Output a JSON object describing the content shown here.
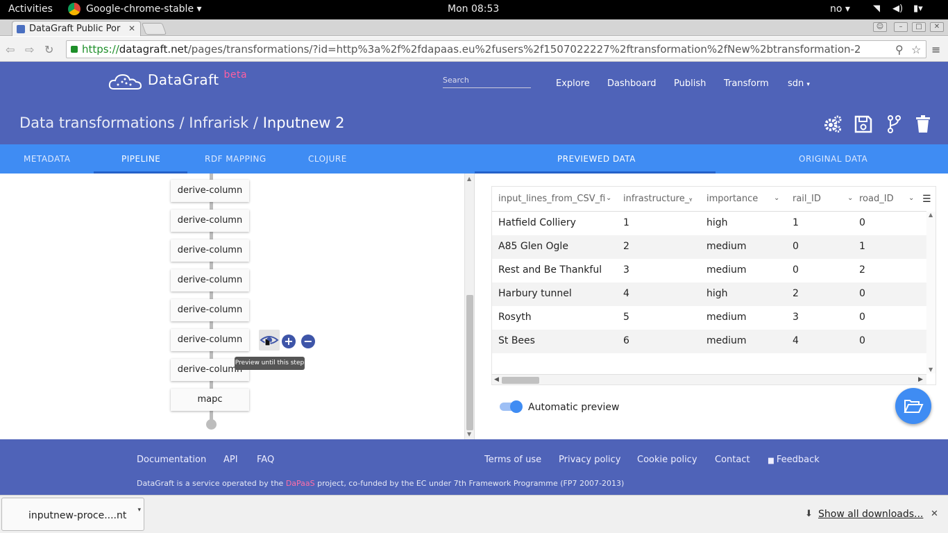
{
  "system": {
    "activities": "Activities",
    "app_name": "Google-chrome-stable",
    "clock": "Mon 08:53",
    "keyboard": "no"
  },
  "browser": {
    "tab_title": "DataGraft Public Por",
    "url_scheme": "https://",
    "url_host": "datagraft.net",
    "url_path": "/pages/transformations/?id=http%3a%2f%2fdapaas.eu%2fusers%2f1507022227%2ftransformation%2fNew%2btransformation-2"
  },
  "header": {
    "logo_text": "DataGraft",
    "beta": "beta",
    "search_placeholder": "Search",
    "nav": [
      "Explore",
      "Dashboard",
      "Publish",
      "Transform",
      "sdn"
    ]
  },
  "breadcrumb": {
    "part1": "Data transformations",
    "part2": "Infrarisk",
    "part3": "Inputnew 2",
    "separator": "/"
  },
  "tabs": {
    "left": [
      "METADATA",
      "PIPELINE",
      "RDF MAPPING",
      "CLOJURE"
    ],
    "right": [
      "PREVIEWED DATA",
      "ORIGINAL DATA"
    ],
    "active_left": "PIPELINE",
    "active_right": "PREVIEWED DATA"
  },
  "pipeline": {
    "steps": [
      "derive-column",
      "derive-column",
      "derive-column",
      "derive-column",
      "derive-column",
      "derive-column",
      "derive-column",
      "mapc"
    ],
    "tooltip": "Preview until this step"
  },
  "table": {
    "columns": [
      "input_lines_from_CSV_fi...",
      "infrastructure_...",
      "importance",
      "rail_ID",
      "road_ID"
    ],
    "rows": [
      [
        "Hatfield Colliery",
        "1",
        "high",
        "1",
        "0"
      ],
      [
        "A85 Glen Ogle",
        "2",
        "medium",
        "0",
        "1"
      ],
      [
        "Rest and Be Thankful",
        "3",
        "medium",
        "0",
        "2"
      ],
      [
        "Harbury tunnel",
        "4",
        "high",
        "2",
        "0"
      ],
      [
        "Rosyth",
        "5",
        "medium",
        "3",
        "0"
      ],
      [
        "St Bees",
        "6",
        "medium",
        "4",
        "0"
      ]
    ]
  },
  "auto_preview": {
    "label": "Automatic preview",
    "enabled": true
  },
  "footer": {
    "links": [
      "Documentation",
      "API",
      "FAQ",
      "Terms of use",
      "Privacy policy",
      "Cookie policy",
      "Contact",
      "Feedback"
    ],
    "credit_before": "DataGraft is a service operated by the",
    "credit_link": "DaPaaS",
    "credit_after": "project, co-funded by the EC under 7th Framework Programme (FP7 2007-2013)"
  },
  "downloads": {
    "file": "inputnew-proce....nt",
    "show_all": "Show all downloads..."
  },
  "colors": {
    "brand": "#4f63b8",
    "tab_bar": "#3f8cf3",
    "accent_pink": "#ff5fa2"
  }
}
